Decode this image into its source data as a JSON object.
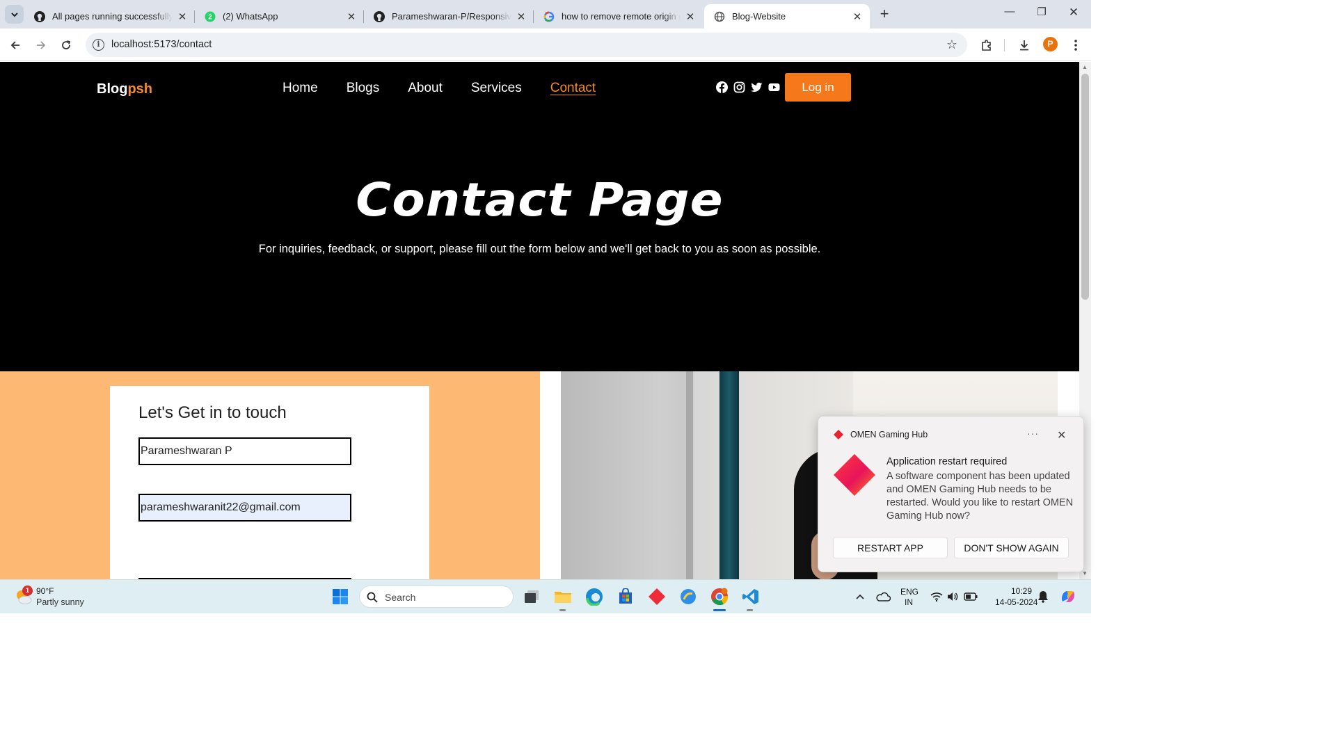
{
  "browser": {
    "tabs": [
      {
        "title": "All pages running successfully ·",
        "favicon": "github-icon"
      },
      {
        "title": "(2) WhatsApp",
        "favicon": "whatsapp-icon",
        "badge": "2"
      },
      {
        "title": "Parameshwaran-P/Responsive-I",
        "favicon": "github-icon"
      },
      {
        "title": "how to remove remote origin g",
        "favicon": "google-icon"
      },
      {
        "title": "Blog-Website",
        "favicon": "globe-icon"
      }
    ],
    "url": "localhost:5173/contact",
    "profile_initial": "P"
  },
  "site": {
    "logo_main": "Blog",
    "logo_accent": "psh",
    "nav": [
      "Home",
      "Blogs",
      "About",
      "Services",
      "Contact"
    ],
    "active_nav": "Contact",
    "login_label": "Log in",
    "hero_title": "Contact Page",
    "hero_subtitle": "For inquiries, feedback, or support, please fill out the form below and we'll get back to you as soon as possible.",
    "form": {
      "title": "Let's Get in to touch",
      "name_value": "Parameshwaran P",
      "email_value": "parameshwaranit22@gmail.com"
    },
    "colors": {
      "accent": "#f58b2a",
      "header_bg": "#000000",
      "form_bg": "#fdb873"
    }
  },
  "notification": {
    "app": "OMEN Gaming Hub",
    "heading": "Application restart required",
    "body": "A software component has been updated and OMEN Gaming Hub needs to be restarted. Would you like to restart OMEN Gaming Hub now?",
    "primary": "RESTART APP",
    "secondary": "DON'T SHOW AGAIN"
  },
  "taskbar": {
    "weather_temp": "90°F",
    "weather_desc": "Partly sunny",
    "weather_badge": "1",
    "search_label": "Search",
    "lang_line1": "ENG",
    "lang_line2": "IN",
    "time": "10:29",
    "date": "14-05-2024"
  }
}
